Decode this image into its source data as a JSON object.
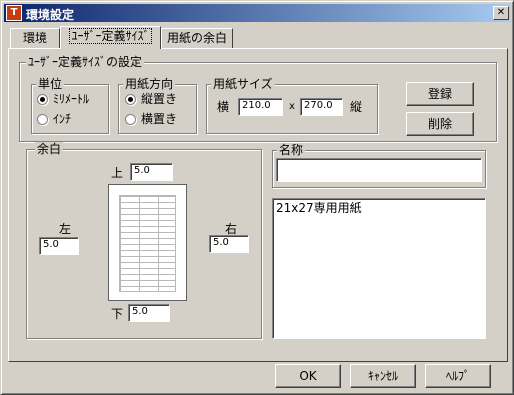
{
  "window": {
    "title": "環境設定",
    "app_icon_text": "T",
    "close_glyph": "✕"
  },
  "tabs": [
    {
      "label": "環境",
      "active": false
    },
    {
      "label": "ﾕｰｻﾞｰ定義ｻｲｽﾞ",
      "active": true
    },
    {
      "label": "用紙の余白",
      "active": false
    }
  ],
  "user_size_group": {
    "title": "ﾕｰｻﾞｰ定義ｻｲｽﾞの設定",
    "unit": {
      "title": "単位",
      "options": [
        {
          "label": "ﾐﾘﾒｰﾄﾙ",
          "checked": true
        },
        {
          "label": "ｲﾝﾁ",
          "checked": false
        }
      ]
    },
    "orientation": {
      "title": "用紙方向",
      "options": [
        {
          "label": "縦置き",
          "checked": true
        },
        {
          "label": "横置き",
          "checked": false
        }
      ]
    },
    "paper_size": {
      "title": "用紙サイズ",
      "width_label": "横",
      "width_value": "210.0",
      "x_separator": "x",
      "height_value": "270.0",
      "height_label": "縦"
    },
    "register_button": "登録",
    "delete_button": "削除"
  },
  "margins": {
    "title": "余白",
    "top_label": "上",
    "top_value": "5.0",
    "left_label": "左",
    "left_value": "5.0",
    "right_label": "右",
    "right_value": "5.0",
    "bottom_label": "下",
    "bottom_value": "5.0"
  },
  "name_group": {
    "title": "名称",
    "value": ""
  },
  "names_list": {
    "items": [
      "21x27専用用紙"
    ]
  },
  "footer": {
    "ok": "OK",
    "cancel": "ｷｬﾝｾﾙ",
    "help": "ﾍﾙﾌﾟ"
  }
}
